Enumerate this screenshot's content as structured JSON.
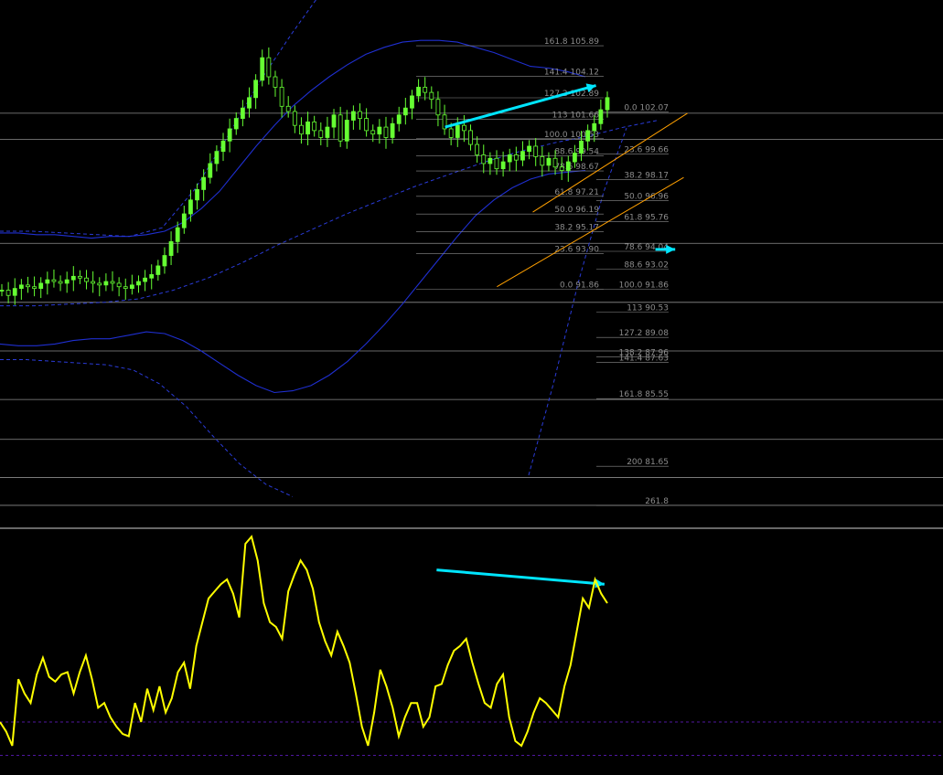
{
  "chart_data": [
    {
      "type": "line",
      "subtype": "candlestick-price-chart",
      "title": "",
      "xlabel": "",
      "ylabel": "",
      "ylim": [
        78.5,
        108.0
      ],
      "grid": false,
      "colors": {
        "background": "#000000",
        "candles": "#66ff33",
        "bands_solid": "#1f2fd0",
        "bands_dashed": "#2a3bd8",
        "fib_lines": "#8c8c8c",
        "channel": "#ffa000",
        "arrow": "#00e5ff",
        "horizontal_lines": "#8c8c8c"
      },
      "close_series": [
        91.8,
        91.5,
        91.9,
        92.1,
        92.0,
        91.9,
        92.2,
        92.4,
        92.3,
        92.2,
        92.4,
        92.6,
        92.5,
        92.3,
        92.2,
        92.1,
        92.3,
        92.2,
        92.0,
        91.9,
        92.1,
        92.3,
        92.5,
        92.7,
        93.2,
        93.8,
        94.6,
        95.4,
        96.2,
        97.0,
        97.6,
        98.3,
        99.1,
        99.8,
        100.4,
        101.1,
        101.7,
        102.3,
        102.9,
        103.9,
        105.2,
        104.1,
        103.5,
        102.4,
        102.1,
        101.3,
        100.8,
        101.5,
        101.0,
        100.6,
        101.2,
        101.9,
        100.4,
        101.6,
        102.1,
        101.7,
        101.0,
        100.8,
        101.2,
        100.6,
        101.4,
        101.9,
        102.3,
        103.0,
        103.5,
        103.2,
        102.8,
        101.9,
        101.1,
        100.6,
        101.3,
        101.0,
        100.2,
        99.6,
        99.1,
        99.4,
        98.8,
        99.2,
        99.6,
        99.3,
        99.8,
        100.1,
        99.5,
        99.0,
        99.4,
        98.9,
        98.7,
        99.2,
        99.7,
        100.4,
        101.0,
        101.4,
        102.2,
        102.9
      ],
      "bands_solid": {
        "upper": [
          95.1,
          95.1,
          95.0,
          95.0,
          94.9,
          94.8,
          94.9,
          94.9,
          95.0,
          95.2,
          95.7,
          96.5,
          97.5,
          98.8,
          100.1,
          101.3,
          102.4,
          103.3,
          104.1,
          104.8,
          105.4,
          105.8,
          106.1,
          106.2,
          106.2,
          106.1,
          105.8,
          105.5,
          105.1,
          104.7,
          104.6,
          104.4,
          104.1
        ],
        "lower": [
          88.7,
          88.6,
          88.6,
          88.7,
          88.9,
          89.0,
          89.0,
          89.2,
          89.4,
          89.3,
          88.9,
          88.3,
          87.6,
          86.9,
          86.3,
          85.9,
          86.0,
          86.3,
          86.9,
          87.7,
          88.7,
          89.8,
          91.0,
          92.3,
          93.6,
          94.9,
          96.1,
          97.0,
          97.7,
          98.2,
          98.5,
          98.6,
          98.7
        ]
      },
      "bands_dashed": {
        "upper": [
          95.2,
          95.2,
          95.1,
          95.0,
          94.9,
          95.4,
          97.6,
          100.6,
          103.8,
          106.6,
          109.2,
          111.3
        ],
        "middle": [
          90.9,
          90.9,
          91.0,
          91.1,
          91.3,
          91.8,
          92.5,
          93.4,
          94.4,
          95.3,
          96.2,
          97.0,
          97.8,
          98.5,
          99.2,
          99.8,
          100.3,
          100.7,
          101.2,
          101.6
        ],
        "lower": [
          87.8,
          87.8,
          87.7,
          87.6,
          87.5,
          87.2,
          86.4,
          85.1,
          83.4,
          81.8,
          80.6,
          79.9
        ]
      },
      "horizontal_levels": [
        102.0,
        100.5,
        94.5,
        91.1,
        88.3,
        85.5,
        83.2,
        81.0,
        79.4
      ],
      "fib_retracement_left": [
        {
          "label": "161.8 105.89",
          "value": 105.89
        },
        {
          "label": "141.4 104.12",
          "value": 104.12
        },
        {
          "label": "127.2 102.89",
          "value": 102.89
        },
        {
          "label": "113 101.66",
          "value": 101.66
        },
        {
          "label": "100.0 100.53",
          "value": 100.53
        },
        {
          "label": "88.6 99.54",
          "value": 99.54
        },
        {
          "label": "78.6 98.67",
          "value": 98.67
        },
        {
          "label": "61.8 97.21",
          "value": 97.21
        },
        {
          "label": "50.0 96.19",
          "value": 96.19
        },
        {
          "label": "38.2 95.17",
          "value": 95.17
        },
        {
          "label": "23.6 93.90",
          "value": 93.9
        },
        {
          "label": "0.0 91.86",
          "value": 91.86
        }
      ],
      "fib_retracement_right": [
        {
          "label": "0.0 102.07",
          "value": 102.07
        },
        {
          "label": "23.6 99.66",
          "value": 99.66
        },
        {
          "label": "38.2 98.17",
          "value": 98.17
        },
        {
          "label": "50.0 96.96",
          "value": 96.96
        },
        {
          "label": "61.8 95.76",
          "value": 95.76
        },
        {
          "label": "78.6 94.04",
          "value": 94.04
        },
        {
          "label": "88.6 93.02",
          "value": 93.02
        },
        {
          "label": "100.0 91.86",
          "value": 91.86
        },
        {
          "label": "113 90.53",
          "value": 90.53
        },
        {
          "label": "127.2 89.08",
          "value": 89.08
        },
        {
          "label": "138.2 87.96",
          "value": 87.96
        },
        {
          "label": "141.4 87.63",
          "value": 87.63
        },
        {
          "label": "161.8 85.55",
          "value": 85.55
        },
        {
          "label": "200 81.65",
          "value": 81.65
        },
        {
          "label": "261.8",
          "value": 79.4
        }
      ],
      "channel": {
        "upper": [
          [
            0.565,
            96.3
          ],
          [
            0.729,
            102.0
          ]
        ],
        "lower": [
          [
            0.527,
            92.0
          ],
          [
            0.725,
            98.3
          ]
        ]
      },
      "arrows": [
        {
          "from": [
            0.472,
            101.2
          ],
          "to": [
            0.632,
            103.6
          ],
          "meaning": "higher high"
        },
        {
          "from": [
            0.695,
            94.15
          ],
          "to": [
            0.716,
            94.15
          ],
          "meaning": "marker"
        }
      ]
    },
    {
      "type": "line",
      "subtype": "oscillator",
      "title": "",
      "xlabel": "",
      "ylabel": "",
      "ylim": [
        0,
        100
      ],
      "colors": {
        "line": "#ffff00",
        "levels": "#6a1fd6",
        "arrow": "#00e5ff"
      },
      "levels": [
        20,
        6
      ],
      "series": [
        {
          "values": [
            20,
            16,
            10,
            38,
            32,
            28,
            40,
            47,
            39,
            37,
            40,
            41,
            32,
            41,
            48,
            38,
            26,
            28,
            22,
            18,
            15,
            14,
            28,
            20,
            34,
            25,
            35,
            24,
            30,
            41,
            45,
            34,
            52,
            62,
            72,
            75,
            78,
            80,
            74,
            64,
            95,
            98,
            88,
            70,
            62,
            60,
            55,
            75,
            82,
            88,
            84,
            76,
            62,
            54,
            48,
            58,
            52,
            45,
            32,
            18,
            10,
            24,
            42,
            35,
            26,
            14,
            22,
            28,
            28,
            18,
            22,
            35,
            36,
            44,
            50,
            52,
            55,
            45,
            36,
            28,
            26,
            36,
            40,
            22,
            12,
            10,
            16,
            24,
            30,
            28,
            25,
            22,
            35,
            44,
            58,
            72,
            68,
            80,
            74,
            70
          ]
        }
      ],
      "arrows": [
        {
          "from": [
            0.463,
            84
          ],
          "to": [
            0.641,
            78
          ],
          "meaning": "lower high (divergence)"
        }
      ]
    }
  ]
}
